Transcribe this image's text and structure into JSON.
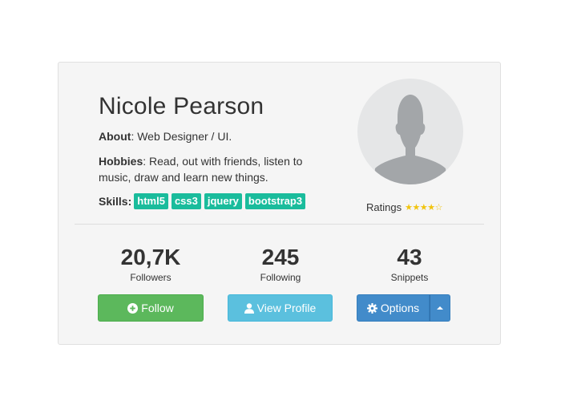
{
  "profile": {
    "name": "Nicole Pearson",
    "about_label": "About",
    "about_value": ": Web Designer / UI.",
    "hobbies_label": "Hobbies",
    "hobbies_value": ": Read, out with friends, listen to music, draw and learn new things.",
    "skills_label": "Skills",
    "skills_colon": ":",
    "skills": [
      "html5",
      "css3",
      "jquery",
      "bootstrap3"
    ],
    "ratings_label": "Ratings",
    "rating": {
      "value": 4,
      "max": 5
    }
  },
  "stats": [
    {
      "value": "20,7K",
      "label": "Followers"
    },
    {
      "value": "245",
      "label": "Following"
    },
    {
      "value": "43",
      "label": "Snippets"
    }
  ],
  "actions": {
    "follow_label": "Follow",
    "view_profile_label": "View Profile",
    "options_label": "Options"
  },
  "colors": {
    "tag": "#1abc9c",
    "follow": "#5cb85c",
    "view_profile": "#5bc0de",
    "options": "#428bca",
    "star": "#f1c40f"
  },
  "icons": {
    "follow": "plus-circle-icon",
    "view_profile": "user-icon",
    "options": "gear-icon",
    "options_toggle": "caret-up-icon",
    "avatar": "person-silhouette-icon"
  }
}
